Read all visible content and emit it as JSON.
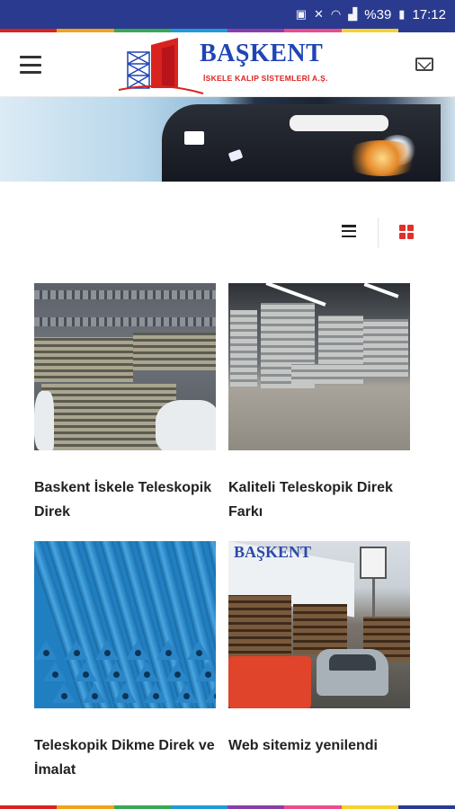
{
  "status_bar": {
    "icons": [
      "sim-icon",
      "mute-icon",
      "wifi-icon",
      "signal-icon",
      "battery-icon"
    ],
    "battery": "%39",
    "time": "17:12"
  },
  "accent_colors": [
    "#d9231f",
    "#f2a21c",
    "#3aa757",
    "#1f9bd7",
    "#8a3fa8",
    "#e94e8a",
    "#f7d12f",
    "#2a3b8f"
  ],
  "header": {
    "brand_name": "BAŞKENT",
    "brand_tagline": "İSKELE KALIP SİSTEMLERİ A.Ş.",
    "menu_icon": "hamburger-menu-icon",
    "mail_icon": "mail-icon"
  },
  "view_toggle": {
    "options": [
      "list-view-icon",
      "grid-view-icon"
    ],
    "selected": "grid-view-icon"
  },
  "posts": [
    {
      "title": "Baskent İskele Teleskopik Direk",
      "image": "stacked-scaffolding-photo"
    },
    {
      "title": "Kaliteli Teleskopik Direk Farkı",
      "image": "warehouse-props-photo"
    },
    {
      "title": "Teleskopik Dikme Direk ve İmalat",
      "image": "blue-props-photo"
    },
    {
      "title": "Web sitemiz yenilendi",
      "image": "company-yard-photo"
    }
  ]
}
